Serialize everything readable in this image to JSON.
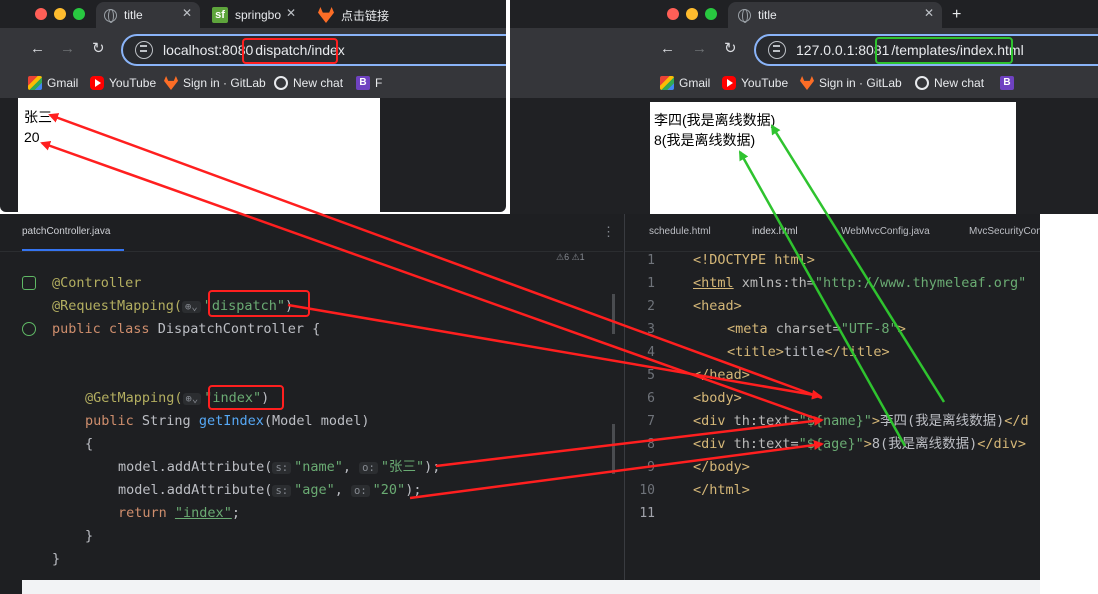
{
  "browser_left": {
    "tabs": [
      {
        "label": "title",
        "icon": "globe-icon",
        "close": "✕"
      },
      {
        "label": "springbo",
        "icon": "sf-icon",
        "close": "✕"
      },
      {
        "label": "点击链接",
        "icon": "gitlab-icon"
      }
    ],
    "address": {
      "host": "localhost:8080",
      "path": "dispatch/index"
    },
    "bookmarks": [
      "Gmail",
      "YouTube",
      "Sign in · GitLab",
      "New chat",
      "F"
    ],
    "content": [
      "张三",
      "20"
    ]
  },
  "browser_right": {
    "tabs": [
      {
        "label": "title",
        "icon": "globe-icon",
        "close": "✕"
      }
    ],
    "new_tab": "+",
    "address": {
      "host": "127.0.0.1:8081",
      "path": "/templates/index.html"
    },
    "bookmarks": [
      "Gmail",
      "YouTube",
      "Sign in · GitLab",
      "New chat",
      "B"
    ],
    "content": [
      "李四(我是离线数据)",
      "8(我是离线数据)"
    ]
  },
  "ide_left": {
    "tab": "patchController.java",
    "warnings": "⚠6 ⚠1",
    "lines": {
      "l1": {
        "ann": "@Controller"
      },
      "l2": {
        "ann": "@RequestMapping(",
        "arg": "\"dispatch\"",
        "close": ")"
      },
      "l3": {
        "kw1": "public",
        "kw2": "class",
        "name": "DispatchController {"
      },
      "l6": {
        "ann": "@GetMapping(",
        "arg": "\"index\"",
        "close": ")"
      },
      "l7": {
        "kw": "public",
        "type": "String",
        "method": "getIndex",
        "params": "(Model model)"
      },
      "l8": {
        "text": "{"
      },
      "l9": {
        "call": "model.addAttribute(",
        "h1": "s:",
        "a1": "\"name\"",
        "sep": ",",
        "h2": "o:",
        "a2": "\"张三\"",
        "end": ");"
      },
      "l10": {
        "call": "model.addAttribute(",
        "h1": "s:",
        "a1": "\"age\"",
        "sep": ",",
        "h2": "o:",
        "a2": "\"20\"",
        "end": ");"
      },
      "l11": {
        "kw": "return",
        "str": "\"index\"",
        "end": ";"
      },
      "l12": {
        "text": "}"
      },
      "l13": {
        "text": "}"
      }
    }
  },
  "ide_right": {
    "tabs": [
      "schedule.html",
      "index.html",
      "WebMvcConfig.java",
      "MvcSecurityCon"
    ],
    "line_numbers": [
      "1",
      "1",
      "2",
      "3",
      "4",
      "5",
      "6",
      "7",
      "8",
      "9",
      "10",
      "11"
    ],
    "lines": {
      "r1": "<!DOCTYPE html>",
      "r2": {
        "tag": "<html",
        "attr": " xmlns:th=",
        "str": "\"http://www.thymeleaf.org\""
      },
      "r3": "<head>",
      "r4": {
        "tag": "<meta",
        "attr": " charset=",
        "str": "\"UTF-8\"",
        "end": ">"
      },
      "r5": {
        "tag": "<title>",
        "text": "title",
        "end": "</title>"
      },
      "r6": "</head>",
      "r7": "<body>",
      "r8": {
        "tag": "<div",
        "attr": " th:text=",
        "str": "\"${name}\"",
        "end": ">",
        "text": "李四(我是离线数据)",
        "close": "</d"
      },
      "r9": {
        "tag": "<div",
        "attr": " th:text=",
        "str": "\"${age}\"",
        "end": ">",
        "text": "8(我是离线数据)",
        "close": "</div>"
      },
      "r10": "</body>",
      "r11": "</html>"
    }
  }
}
